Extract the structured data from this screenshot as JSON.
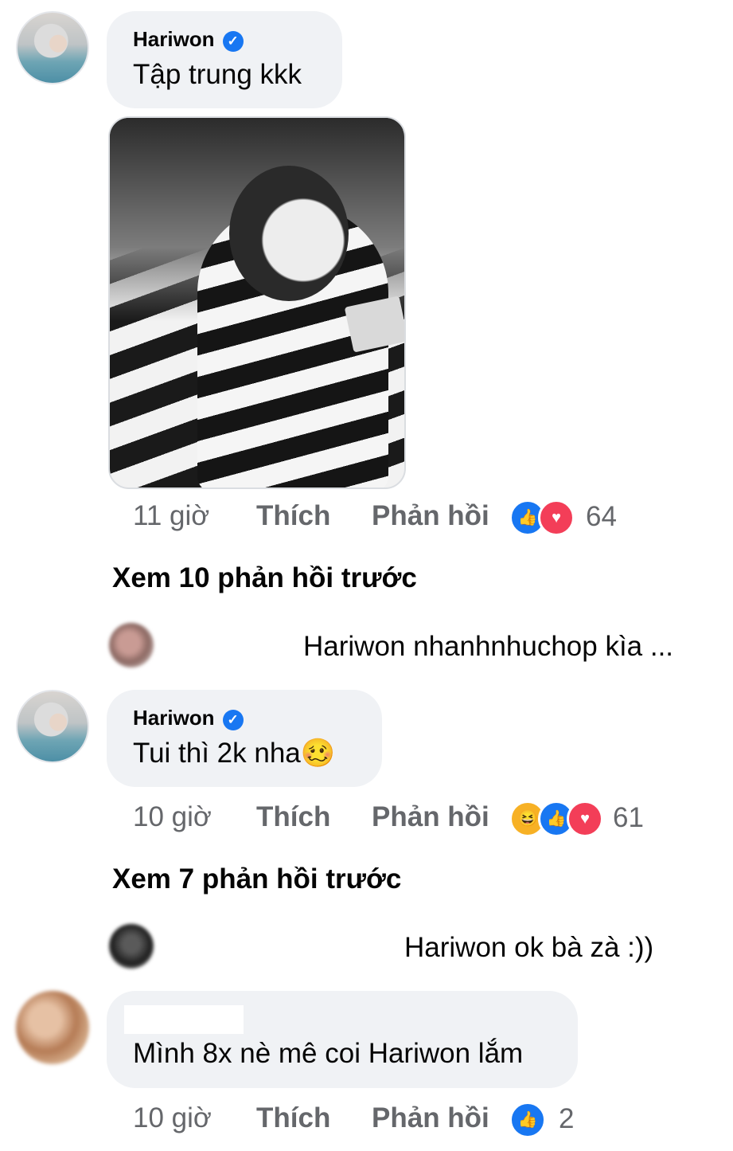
{
  "comments": [
    {
      "author": "Hariwon",
      "text": "Tập trung kkk",
      "time": "11 giờ",
      "like_label": "Thích",
      "reply_label": "Phản hồi",
      "reactions": [
        "like",
        "love"
      ],
      "reaction_count": "64",
      "view_more": "Xem 10 phản hồi trước",
      "reply_preview": "Hariwon nhanhnhuchop kìa ..."
    },
    {
      "author": "Hariwon",
      "text": "Tui thì 2k nha🥴",
      "time": "10 giờ",
      "like_label": "Thích",
      "reply_label": "Phản hồi",
      "reactions": [
        "haha",
        "like",
        "love"
      ],
      "reaction_count": "61",
      "view_more": "Xem 7 phản hồi trước",
      "reply_preview": "Hariwon ok bà zà :))"
    },
    {
      "author": "",
      "text": "Mình 8x nè mê coi Hariwon lắm",
      "time": "10 giờ",
      "like_label": "Thích",
      "reply_label": "Phản hồi",
      "reactions": [
        "like"
      ],
      "reaction_count": "2"
    }
  ],
  "icons": {
    "verified": "verified-check-icon",
    "like": "like-reaction-icon",
    "love": "love-reaction-icon",
    "haha": "haha-reaction-icon"
  },
  "colors": {
    "bubble": "#f0f2f5",
    "meta": "#65676b",
    "like": "#1877f2",
    "love": "#f33e58"
  }
}
